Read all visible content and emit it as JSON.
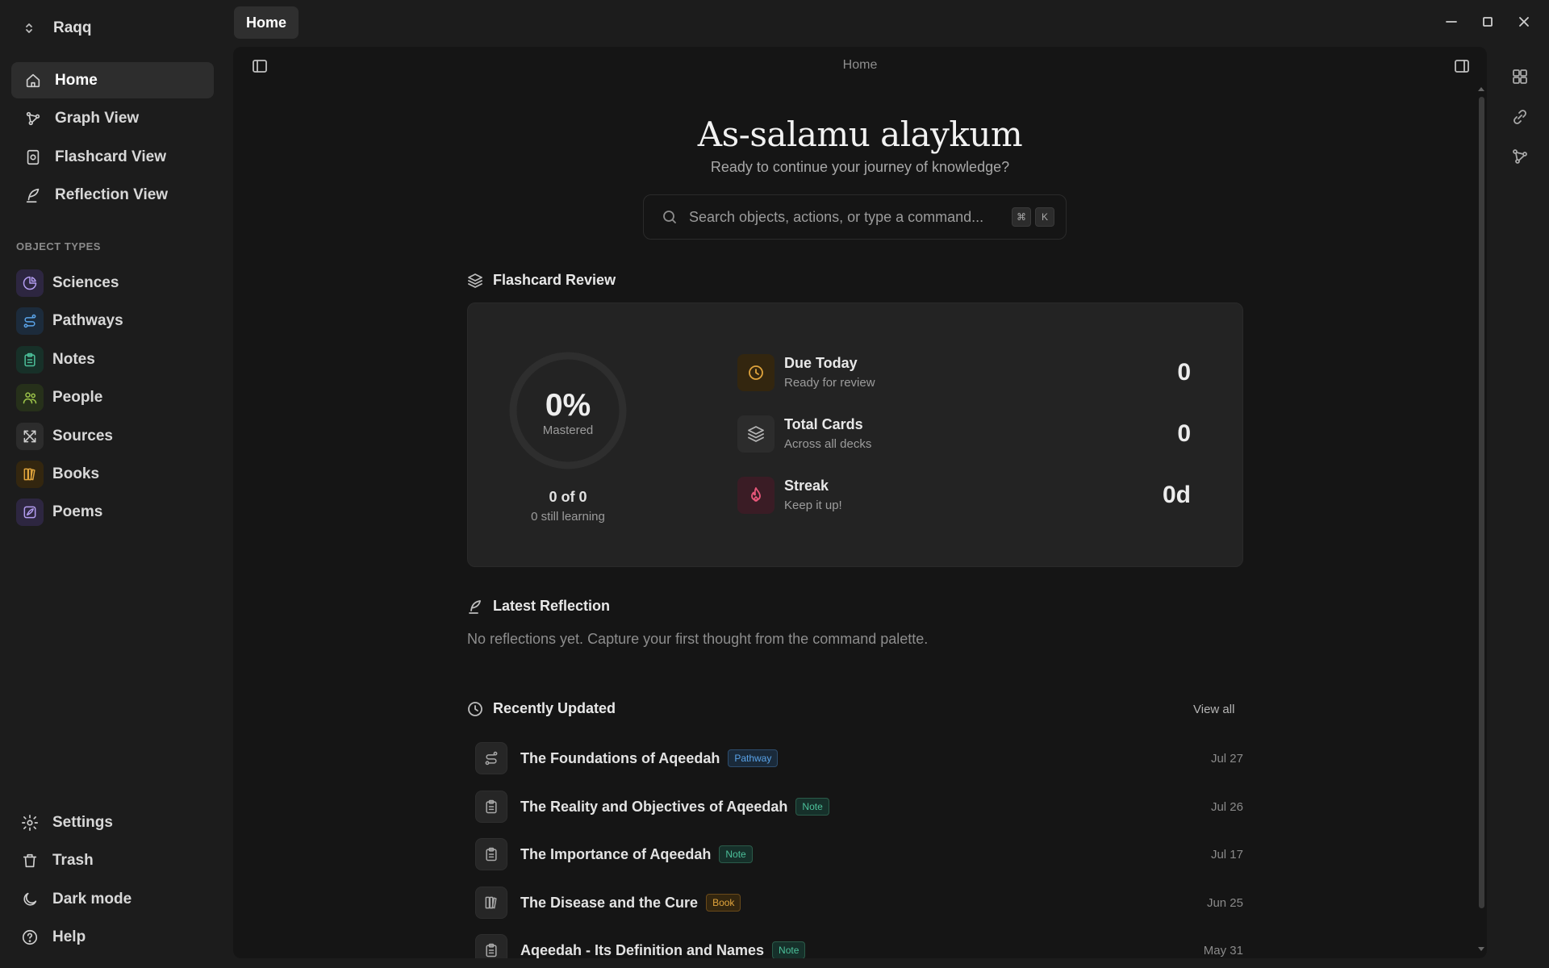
{
  "app": {
    "workspace_name": "Raqq"
  },
  "nav": [
    {
      "label": "Home",
      "icon": "home-icon",
      "active": true
    },
    {
      "label": "Graph View",
      "icon": "graph-icon"
    },
    {
      "label": "Flashcard View",
      "icon": "flashcard-icon"
    },
    {
      "label": "Reflection View",
      "icon": "quill-icon"
    }
  ],
  "object_types": {
    "label": "OBJECT TYPES",
    "items": [
      {
        "label": "Sciences",
        "icon": "sciences-icon",
        "color": "#b39cf0"
      },
      {
        "label": "Pathways",
        "icon": "pathway-icon",
        "color": "#5aa3e8"
      },
      {
        "label": "Notes",
        "icon": "note-icon",
        "color": "#4cc09a"
      },
      {
        "label": "People",
        "icon": "people-icon",
        "color": "#9cc44a"
      },
      {
        "label": "Sources",
        "icon": "sources-icon",
        "color": "#cfcfcf"
      },
      {
        "label": "Books",
        "icon": "book-icon",
        "color": "#e0a43c"
      },
      {
        "label": "Poems",
        "icon": "feather-icon",
        "color": "#b39cf0"
      }
    ]
  },
  "bottom_nav": [
    {
      "label": "Settings",
      "icon": "gear-icon"
    },
    {
      "label": "Trash",
      "icon": "trash-icon"
    },
    {
      "label": "Dark mode",
      "icon": "moon-icon"
    },
    {
      "label": "Help",
      "icon": "help-icon"
    }
  ],
  "tab": {
    "label": "Home"
  },
  "window_controls": [
    "minimize-icon",
    "maximize-icon",
    "close-icon"
  ],
  "breadcrumb": "Home",
  "greeting": {
    "title": "As-salamu alaykum",
    "subtitle": "Ready to continue your journey of knowledge?"
  },
  "search": {
    "placeholder": "Search objects, actions, or type a command...",
    "shortcut_mod": "⌘",
    "shortcut_key": "K"
  },
  "flashcard_review": {
    "title": "Flashcard Review",
    "mastered_percent": "0%",
    "mastered_label": "Mastered",
    "mastered_fraction": 0,
    "count_text": "0 of 0",
    "learning_text": "0 still learning",
    "stats": [
      {
        "title": "Due Today",
        "subtitle": "Ready for review",
        "value": "0",
        "icon": "clock-icon",
        "color": "#e0a43c"
      },
      {
        "title": "Total Cards",
        "subtitle": "Across all decks",
        "value": "0",
        "icon": "layers-icon",
        "color": "#b5b5b5"
      },
      {
        "title": "Streak",
        "subtitle": "Keep it up!",
        "value": "0d",
        "icon": "flame-icon",
        "color": "#e8577a"
      }
    ]
  },
  "latest_reflection": {
    "title": "Latest Reflection",
    "empty_text": "No reflections yet. Capture your first thought from the command palette."
  },
  "recently_updated": {
    "title": "Recently Updated",
    "view_all": "View all",
    "items": [
      {
        "title": "The Foundations of Aqeedah",
        "tag": "Pathway",
        "date": "Jul 27",
        "icon": "pathway-icon"
      },
      {
        "title": "The Reality and Objectives of Aqeedah",
        "tag": "Note",
        "date": "Jul 26",
        "icon": "note-icon"
      },
      {
        "title": "The Importance of Aqeedah",
        "tag": "Note",
        "date": "Jul 17",
        "icon": "note-icon"
      },
      {
        "title": "The Disease and the Cure",
        "tag": "Book",
        "date": "Jun 25",
        "icon": "book-icon"
      },
      {
        "title": "Aqeedah - Its Definition and Names",
        "tag": "Note",
        "date": "May 31",
        "icon": "note-icon"
      }
    ]
  },
  "right_rail": [
    "grid-icon",
    "link-icon",
    "graph-icon"
  ]
}
